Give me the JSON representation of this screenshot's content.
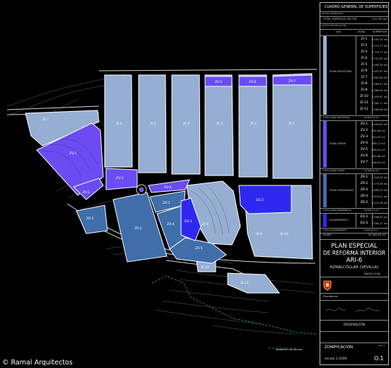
{
  "panel": {
    "table_title": "CUADRO GENERAL DE SUPERFICIES",
    "datos_generales": "DATOS GENERALES",
    "total_sector_label": "TOTAL SUPERFICIE SECTOR",
    "total_sector_value": "110.740 m2",
    "datos_zonificacion": "DATOS ZONIFICACION",
    "col_uso": "USO",
    "col_zona": "ZONA",
    "col_superficie": "SUPERFICIE",
    "groups": [
      {
        "label": "ZONA INDUSTRIAL",
        "color": "#95aed1",
        "total_label": "TOTAL ZONA INDUSTRIAL",
        "total_value": "46.874,67 m2",
        "rows": [
          {
            "code": "ZI-1",
            "value": "6.004,10 m2"
          },
          {
            "code": "ZI-2",
            "value": "5.715,77 m2"
          },
          {
            "code": "ZI-3",
            "value": "5.715,77 m2"
          },
          {
            "code": "ZI-4",
            "value": "5.702,60 m2"
          },
          {
            "code": "ZI-5",
            "value": "5.460,39 m2"
          },
          {
            "code": "ZI-6",
            "value": "5.497,67 m2"
          },
          {
            "code": "ZI-7",
            "value": "3.887,96 m2"
          },
          {
            "code": "ZI-8",
            "value": "7.080,91 m2"
          },
          {
            "code": "ZI-9",
            "value": "4.580,04 m2"
          },
          {
            "code": "ZI-10",
            "value": "5.455,67 m2"
          },
          {
            "code": "ZI-11",
            "value": "2.581,17 m2"
          },
          {
            "code": "ZI-12",
            "value": "2.960,48 m2"
          }
        ]
      },
      {
        "label": "ZONA VERDE",
        "color": "#6a4cf2",
        "total_label": "TOTAL ZONA VERDE",
        "total_value": "13.306,40 m2",
        "rows": [
          {
            "code": "ZV-1",
            "value": "6.109,00 m2"
          },
          {
            "code": "ZV-2",
            "value": "605,06 m2"
          },
          {
            "code": "ZV-3",
            "value": "920,33 m2"
          },
          {
            "code": "ZV-4",
            "value": "589,71 m2"
          },
          {
            "code": "ZV-5",
            "value": "606,42 m2"
          },
          {
            "code": "ZV-6",
            "value": "604,66 m2"
          },
          {
            "code": "ZV-7",
            "value": "598,55 m2"
          }
        ]
      },
      {
        "label": "ZONA RESIDENCIAL",
        "color": "#3f6eab",
        "total_label": "TOTAL ZONA RESIDENCIAL",
        "total_value": "18.264,22 m2",
        "rows": [
          {
            "code": "ZR-1",
            "value": "1.544,55 m2"
          },
          {
            "code": "ZR-2",
            "value": "4.773,96 m2"
          },
          {
            "code": "ZR-3",
            "value": "1.865,19 m2"
          },
          {
            "code": "ZR-4",
            "value": "5.870,41 m2"
          },
          {
            "code": "ZR-5",
            "value": "4.222,38 m2"
          }
        ]
      },
      {
        "label": "EQUIPAMIENTO",
        "color": "#2f28f0",
        "total_label": "TOTAL EQUIPAMIENTO",
        "total_value": "8.631,94 m2",
        "rows": [
          {
            "code": "EQ-1",
            "value": "1.566,00 m2"
          },
          {
            "code": "EQ-2",
            "value": "7.065,17 m2"
          }
        ]
      }
    ],
    "viario_label": "VIARIO",
    "viario_value": "30.902,85 m2",
    "project_title_1": "PLAN ESPECIAL",
    "project_title_2": "DE REFORMA INTERIOR",
    "project_title_3": "ARI-6",
    "location": "AZNALCÓLLAR (SEVILLA)",
    "date": "MARZO 2009",
    "propietarios": "Propietarios",
    "ordenacion": "ORDENACIÓN",
    "plan_name": "ZONIFICACIÓN",
    "scale": "escala 1:1000",
    "plan_number_label": "plano nº",
    "plan_number": "O.1"
  },
  "map": {
    "zone_labels": {
      "ZI-1": "ZI-1",
      "ZI-2": "ZI-2",
      "ZI-3": "ZI-3",
      "ZI-4": "ZI-4",
      "ZI-5": "ZI-5",
      "ZI-6": "ZI-6",
      "ZI-7": "ZI-7",
      "ZI-8": "ZI-8",
      "ZI-9": "ZI-9",
      "ZI-10": "ZI-10",
      "ZI-11": "ZI-11",
      "ZI-12": "ZI-12",
      "ZV-1": "ZV-1",
      "ZV-2": "ZV-2",
      "ZV-3": "ZV-3",
      "ZV-4": "ZV-4",
      "ZV-5": "ZV-5",
      "ZV-6": "ZV-6",
      "ZV-7": "ZV-7",
      "ZR-1": "ZR-1",
      "ZR-2": "ZR-2",
      "ZR-3": "ZR-3",
      "ZR-4": "ZR-4",
      "ZR-5": "ZR-5",
      "EQ-1": "EQ-1",
      "EQ-2": "EQ-2"
    },
    "boundary_label": "PERIMETRO DEL SECTOR"
  },
  "watermark": "© Ramal Arquitectos",
  "colors": {
    "industrial": "#95aed1",
    "green": "#6a4cf2",
    "residential": "#3f6eab",
    "equipment": "#2f28f0",
    "road": "#0a0a0a",
    "road_edge": "#d8d8d8"
  }
}
